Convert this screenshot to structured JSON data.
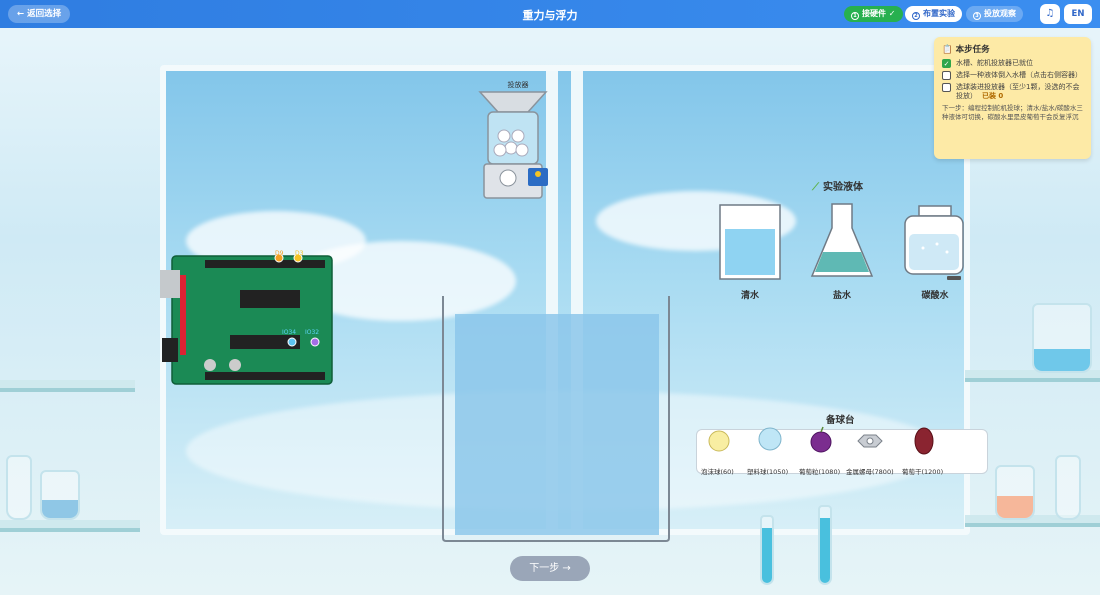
{
  "header": {
    "back_label": "← 返回选择",
    "title": "重力与浮力",
    "connect_label": "接硬件 ✓",
    "setup_label": "布置实验",
    "observe_label": "投放观察",
    "lang_label": "EN"
  },
  "task": {
    "title": "本步任务",
    "items": [
      {
        "label": "水槽、舵机投放器已就位",
        "checked": true
      },
      {
        "label": "选择一种液体倒入水槽（点击右侧容器）",
        "checked": false
      },
      {
        "label": "选球装进投放器（至少1颗，没选的不会投放）",
        "checked": false
      }
    ],
    "loaded_label": "已装 0",
    "note": "下一步：编程控制舵机投球；清水/盐水/碳酸水三种液体可切换，碳酸水里是皮葡萄干会反复浮沉"
  },
  "dispenser": {
    "label": "投放器"
  },
  "arduino": {
    "pin_labels": [
      "D9",
      "D3"
    ],
    "sensor_labels": [
      "IO34",
      "IO32"
    ]
  },
  "liquids": {
    "title": "实验液体",
    "items": [
      {
        "label": "清水",
        "color": "#8fd3f2"
      },
      {
        "label": "盐水",
        "color": "#5fb9b4"
      },
      {
        "label": "碳酸水",
        "color": "#cfe9f6"
      }
    ]
  },
  "tray": {
    "title": "备球台",
    "balls": [
      {
        "label": "泡沫球(60)",
        "color": "#f8eea2"
      },
      {
        "label": "塑料球(1050)",
        "color": "#bfe6f6"
      },
      {
        "label": "葡萄粒(1080)",
        "color": "#7b2d8f"
      },
      {
        "label": "金属螺母(7800)",
        "color": "#c9cdd3"
      },
      {
        "label": "葡萄干(1200)",
        "color": "#8a2430"
      }
    ]
  },
  "next_label": "下一步 →"
}
